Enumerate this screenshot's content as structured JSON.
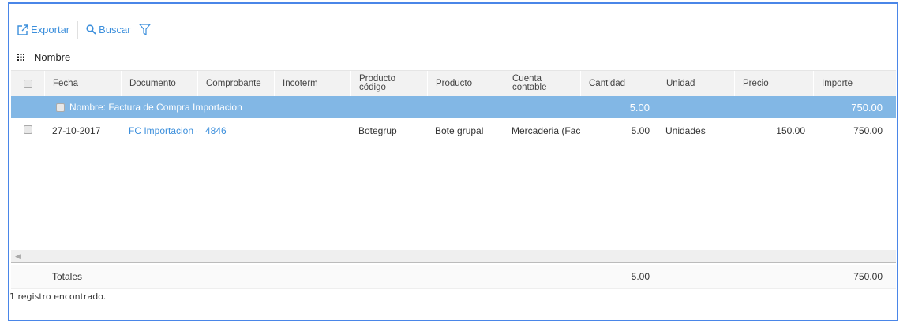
{
  "toolbar": {
    "export_label": "Exportar",
    "search_label": "Buscar"
  },
  "grouping": {
    "label": "Nombre"
  },
  "columns": [
    "Fecha",
    "Documento",
    "Comprobante",
    "Incoterm",
    "Producto código",
    "Producto",
    "Cuenta contable",
    "Cantidad",
    "Unidad",
    "Precio",
    "Importe"
  ],
  "group_row": {
    "label": "Nombre: Factura de Compra Importacion",
    "cantidad": "5.00",
    "importe": "750.00"
  },
  "rows": [
    {
      "fecha": "27-10-2017",
      "documento": "FC Importacion -",
      "comprobante": "4846",
      "incoterm": "",
      "producto_codigo": "Botegrup",
      "producto": "Bote grupal",
      "cuenta": "Mercaderia (Fact",
      "cantidad": "5.00",
      "unidad": "Unidades",
      "precio": "150.00",
      "importe": "750.00"
    }
  ],
  "totals": {
    "label": "Totales",
    "cantidad": "5.00",
    "importe": "750.00"
  },
  "status": "1 registro encontrado."
}
